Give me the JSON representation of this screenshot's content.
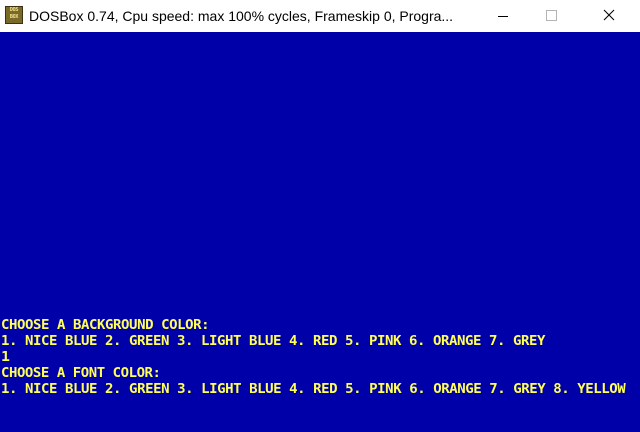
{
  "window": {
    "icon_top": "DOS",
    "icon_bottom": "BOX",
    "title": "DOSBox 0.74, Cpu speed: max 100% cycles, Frameskip  0, Progra..."
  },
  "controls": {
    "minimize": "minimize-icon",
    "maximize": "maximize-icon",
    "close": "close-icon"
  },
  "screen": {
    "background_color": "#0000a8",
    "text_color": "#ffff55",
    "lines": [
      "CHOOSE A BACKGROUND COLOR:",
      "1. NICE BLUE 2. GREEN 3. LIGHT BLUE 4. RED 5. PINK 6. ORANGE 7. GREY",
      "1",
      "CHOOSE A FONT COLOR:",
      "1. NICE BLUE 2. GREEN 3. LIGHT BLUE 4. RED 5. PINK 6. ORANGE 7. GREY 8. YELLOW"
    ]
  }
}
